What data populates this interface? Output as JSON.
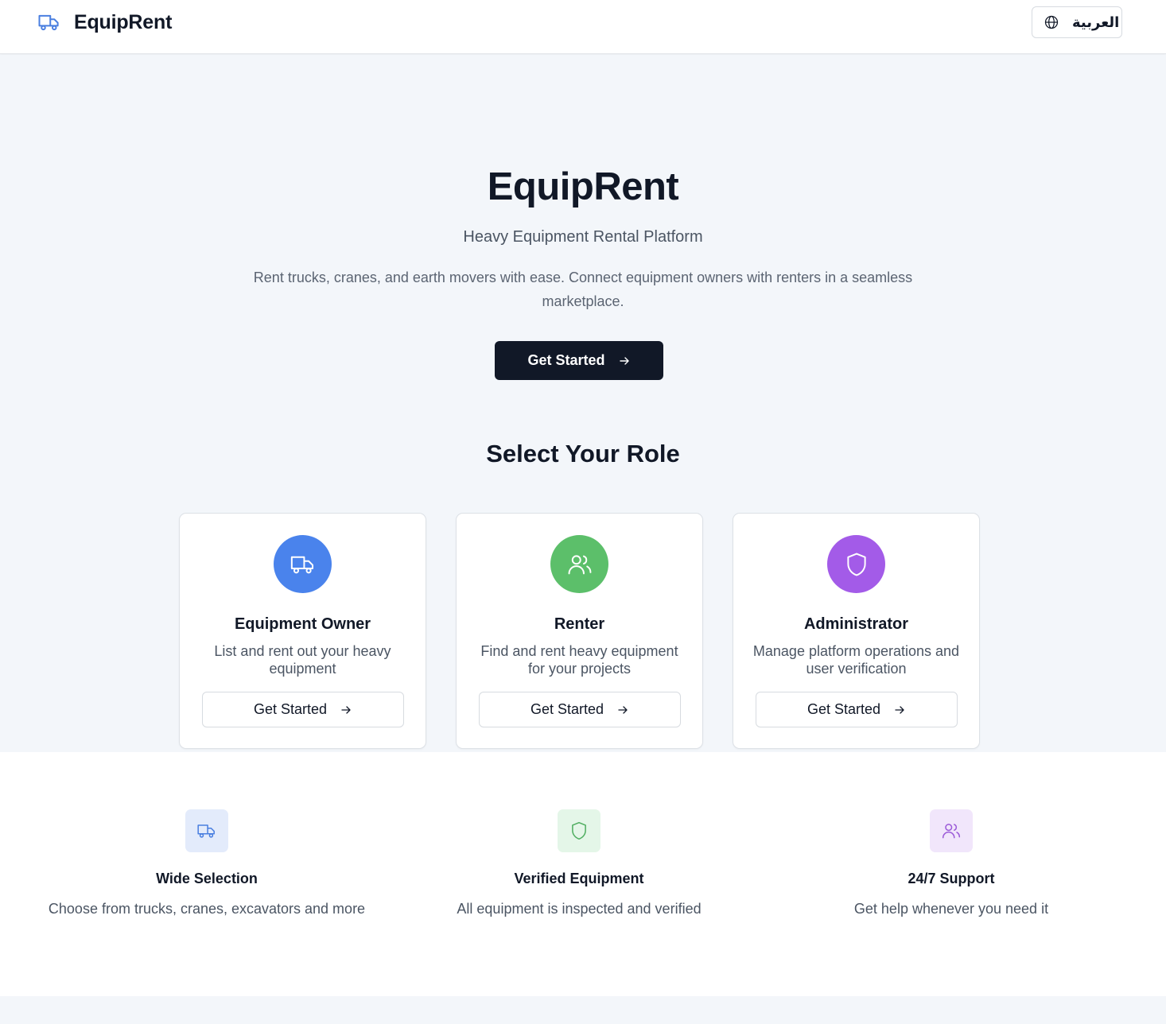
{
  "header": {
    "brand_name": "EquipRent",
    "brand_icon": "truck-icon",
    "language_label": "العربية",
    "language_icon": "globe-icon"
  },
  "hero": {
    "title": "EquipRent",
    "subtitle": "Heavy Equipment Rental Platform",
    "description": "Rent trucks, cranes, and earth movers with ease. Connect equipment owners with renters in a seamless marketplace.",
    "cta_label": "Get Started"
  },
  "roles": {
    "heading": "Select Your Role",
    "items": [
      {
        "name": "Equipment Owner",
        "description": "List and rent out your heavy equipment",
        "button_label": "Get Started",
        "icon": "truck-icon",
        "color": "#4a83ec"
      },
      {
        "name": "Renter",
        "description": "Find and rent heavy equipment for your projects",
        "button_label": "Get Started",
        "icon": "users-icon",
        "color": "#5cbf6a"
      },
      {
        "name": "Administrator",
        "description": "Manage platform operations and user verification",
        "button_label": "Get Started",
        "icon": "shield-icon",
        "color": "#a35be8"
      }
    ]
  },
  "features": {
    "items": [
      {
        "title": "Wide Selection",
        "description": "Choose from trucks, cranes, excavators and more",
        "icon": "truck-icon",
        "color": "#4a7fe0",
        "bg": "#e3ebfb"
      },
      {
        "title": "Verified Equipment",
        "description": "All equipment is inspected and verified",
        "icon": "shield-icon",
        "color": "#4fae60",
        "bg": "#e4f6e8"
      },
      {
        "title": "24/7 Support",
        "description": "Get help whenever you need it",
        "icon": "users-icon",
        "color": "#9b5ad8",
        "bg": "#f1e6fb"
      }
    ]
  },
  "colors": {
    "primary_dark": "#111827",
    "page_bg": "#f3f6fa"
  }
}
